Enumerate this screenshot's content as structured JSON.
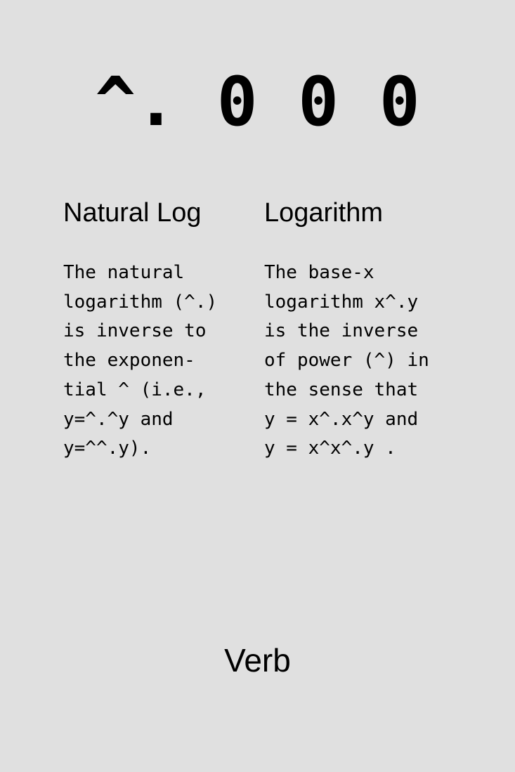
{
  "card": {
    "glyph": "^. 0 0 0",
    "left": {
      "heading": "Natural Log",
      "description": "The natural\nlogarithm (^.)\nis inverse to\nthe exponen-\ntial ^ (i.e.,\ny=^.^y and\ny=^^.y)."
    },
    "right": {
      "heading": "Logarithm",
      "description": "The base-x\nlogarithm x^.y\nis the inverse\nof power (^) in\nthe sense that\ny = x^.x^y and\ny = x^x^.y ."
    },
    "part_of_speech": "Verb"
  }
}
